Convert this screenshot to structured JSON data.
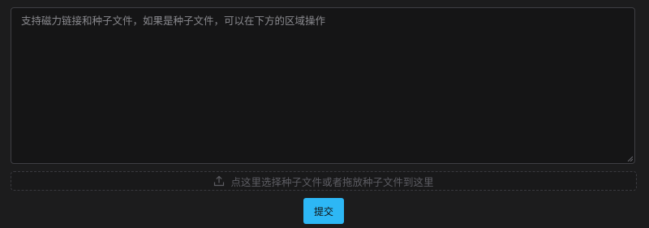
{
  "form": {
    "magnet_input": {
      "value": "",
      "placeholder": "支持磁力链接和种子文件，如果是种子文件，可以在下方的区域操作"
    },
    "upload_zone": {
      "icon": "upload-icon",
      "label": "点这里选择种子文件或者拖放种子文件到这里"
    },
    "submit_label": "提交"
  },
  "colors": {
    "background": "#1c1c1d",
    "accent": "#2db7f5",
    "border": "#3f3f44"
  }
}
